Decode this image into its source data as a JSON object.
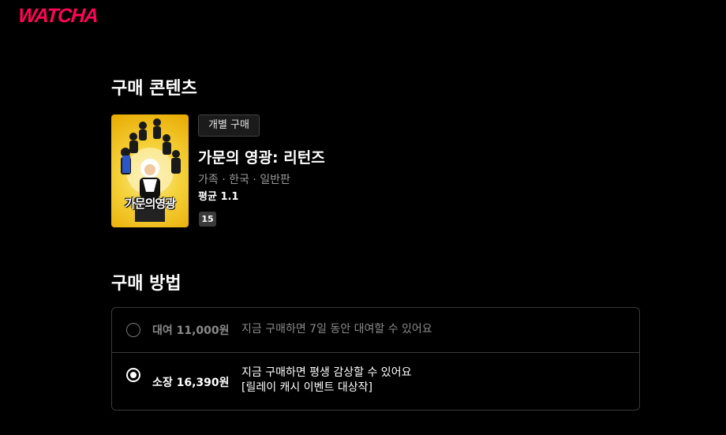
{
  "header": {
    "logo": "WATCHA"
  },
  "purchase_content": {
    "section_title": "구매 콘텐츠",
    "badge": "개별 구매",
    "title": "가문의 영광: 리턴즈",
    "meta": "가족 · 한국 · 일반판",
    "rating_label": "평균 1.1",
    "age_rating": "15",
    "poster_title": "가문의영광"
  },
  "purchase_method": {
    "section_title": "구매 방법",
    "options": [
      {
        "price": "대여 11,000원",
        "description": "지금 구매하면 7일 동안 대여할 수 있어요",
        "description2": "",
        "selected": false
      },
      {
        "price": "소장 16,390원",
        "description": "지금 구매하면 평생 감상할 수 있어요",
        "description2": "[릴레이 캐시 이벤트 대상작]",
        "selected": true
      }
    ]
  },
  "colors": {
    "brand": "#ff0558",
    "background": "#000000",
    "border": "#3a3a3a",
    "muted_text": "#8a8a8a"
  }
}
